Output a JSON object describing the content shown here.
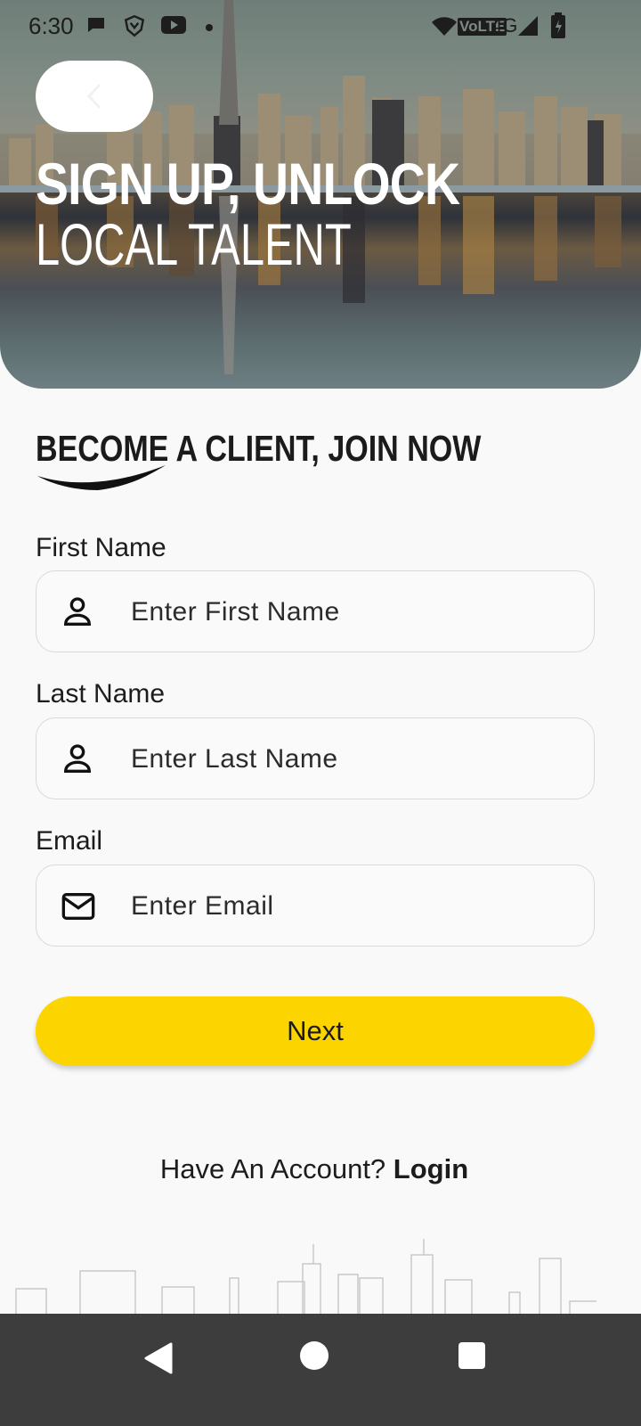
{
  "status_bar": {
    "time": "6:30",
    "network": "VoLTE",
    "signal": "4G"
  },
  "header": {
    "back_label": "back",
    "title_line1": "SIGN UP, UNLOCK",
    "title_line2": "LOCAL TALENT"
  },
  "form": {
    "heading": "BECOME A CLIENT, JOIN NOW",
    "fields": [
      {
        "label": "First Name",
        "placeholder": "Enter First Name",
        "value": "",
        "icon": "person-icon"
      },
      {
        "label": "Last Name",
        "placeholder": "Enter Last Name",
        "value": "",
        "icon": "person-icon"
      },
      {
        "label": "Email",
        "placeholder": "Enter Email",
        "value": "",
        "icon": "mail-icon"
      }
    ],
    "next_label": "Next",
    "account_prompt": "Have An Account?",
    "login_label": "Login"
  },
  "colors": {
    "accent": "#fcd400",
    "background": "#f9f9f9",
    "nav_bar": "#3d3d3d"
  }
}
